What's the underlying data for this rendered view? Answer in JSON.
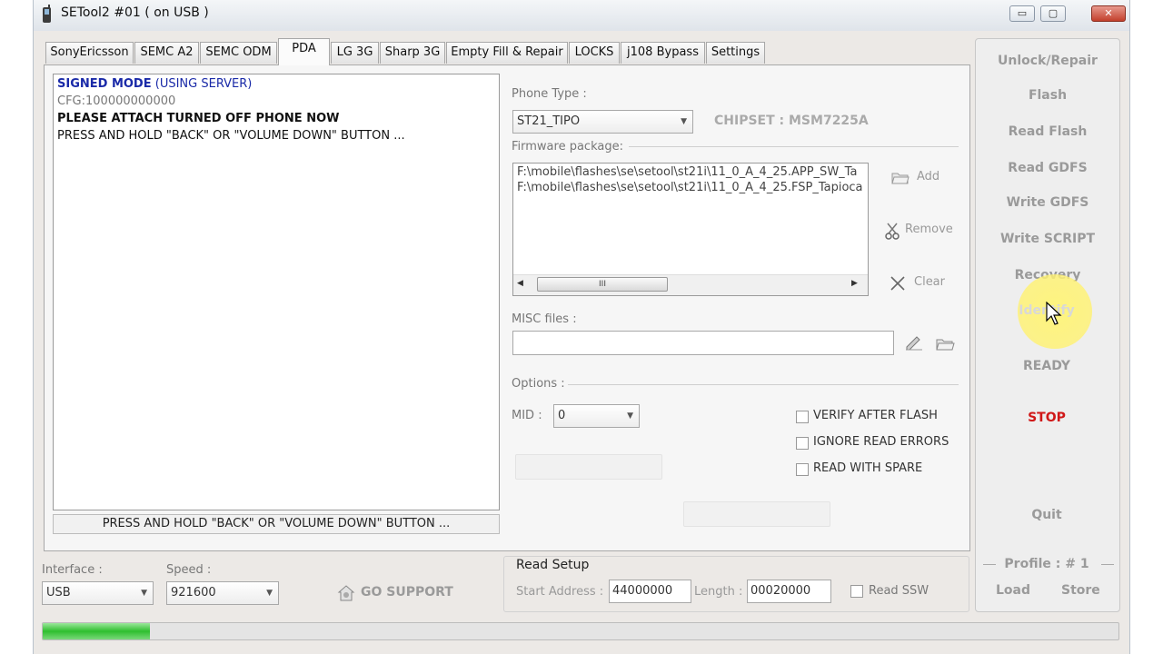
{
  "window": {
    "title": "SETool2 #01 ( on USB )",
    "controls": {
      "minimize": "▭",
      "maximize": "▢",
      "close": "✕"
    }
  },
  "tabs": [
    {
      "label": "SonyEricsson"
    },
    {
      "label": "SEMC A2"
    },
    {
      "label": "SEMC ODM"
    },
    {
      "label": "PDA",
      "active": true
    },
    {
      "label": "LG 3G"
    },
    {
      "label": "Sharp 3G"
    },
    {
      "label": "Empty Fill & Repair"
    },
    {
      "label": "LOCKS"
    },
    {
      "label": "j108 Bypass"
    },
    {
      "label": "Settings"
    }
  ],
  "log": {
    "line1_mode": "SIGNED MODE",
    "line1_server": "(USING SERVER)",
    "line2": "CFG:100000000000",
    "line3": "PLEASE ATTACH TURNED OFF PHONE NOW",
    "line4": "PRESS AND HOLD \"BACK\" OR \"VOLUME DOWN\" BUTTON ...",
    "status": "PRESS AND HOLD \"BACK\" OR \"VOLUME DOWN\" BUTTON ..."
  },
  "phone": {
    "type_label": "Phone Type :",
    "type_value": "ST21_TIPO",
    "chipset": "CHIPSET : MSM7225A"
  },
  "firmware": {
    "label": "Firmware package:",
    "files": [
      "F:\\mobile\\flashes\\se\\setool\\st21i\\11_0_A_4_25.APP_SW_Ta",
      "F:\\mobile\\flashes\\se\\setool\\st21i\\11_0_A_4_25.FSP_Tapioca"
    ],
    "scroll_thumb": "III",
    "add": "Add",
    "remove": "Remove",
    "clear": "Clear"
  },
  "misc": {
    "label": "MISC files :",
    "value": ""
  },
  "options": {
    "label": "Options :",
    "mid_label": "MID :",
    "mid_value": "0",
    "checkboxes": [
      {
        "label": "VERIFY AFTER FLASH",
        "checked": false
      },
      {
        "label": "IGNORE READ ERRORS",
        "checked": false
      },
      {
        "label": "READ WITH SPARE",
        "checked": false
      }
    ]
  },
  "actions": {
    "unlock_repair": "Unlock/Repair",
    "flash": "Flash",
    "read_flash": "Read Flash",
    "read_gdfs": "Read GDFS",
    "write_gdfs": "Write GDFS",
    "write_script": "Write SCRIPT",
    "recovery": "Recovery",
    "identify": "Identify",
    "ready": "READY",
    "stop": "STOP",
    "quit": "Quit",
    "profile": "Profile : # 1",
    "load": "Load",
    "store": "Store"
  },
  "connection": {
    "interface_label": "Interface :",
    "interface_value": "USB",
    "speed_label": "Speed :",
    "speed_value": "921600",
    "go_support": "GO SUPPORT"
  },
  "read_setup": {
    "title": "Read Setup",
    "start_label": "Start Address :",
    "start_value": "44000000",
    "length_label": "Length :",
    "length_value": "00020000",
    "read_ssw": "Read SSW",
    "read_ssw_checked": false
  },
  "progress": {
    "fraction": 0.1
  },
  "colors": {
    "signed_mode": "#1a2aa8",
    "stop": "#d01818",
    "progress": "#2fbf2f",
    "cursor_highlight": "#fff27a"
  }
}
